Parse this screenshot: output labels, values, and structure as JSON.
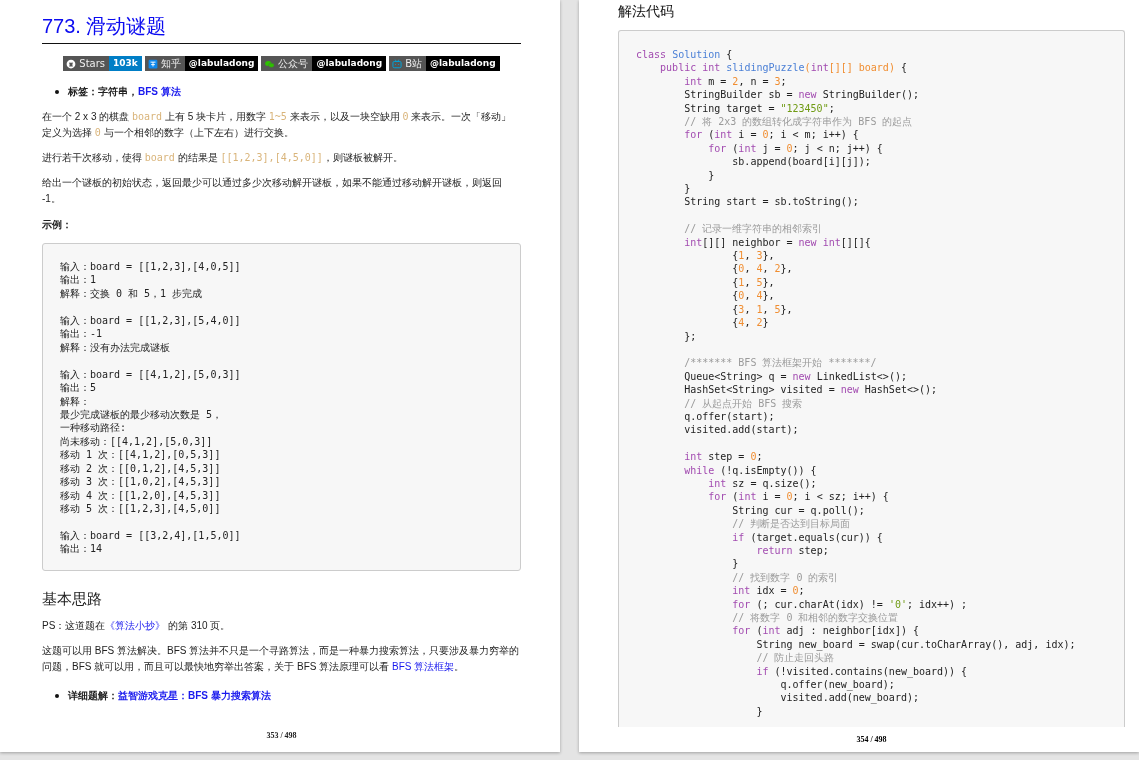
{
  "left_page": {
    "title": "773. 滑动谜题",
    "badges": [
      {
        "kind": "github",
        "label": "Stars",
        "value": "103k"
      },
      {
        "kind": "zhihu",
        "label": "知乎",
        "value": "@labuladong"
      },
      {
        "kind": "wechat",
        "label": "公众号",
        "value": "@labuladong"
      },
      {
        "kind": "bilibili",
        "label": "B站",
        "value": "@labuladong"
      }
    ],
    "blocks": [
      {
        "kind": "bullet",
        "parts": [
          {
            "kind": "text",
            "text": "标签：字符串，"
          },
          {
            "kind": "link",
            "text": "BFS 算法"
          }
        ]
      },
      {
        "kind": "para",
        "parts": [
          {
            "kind": "text",
            "text": "在一个 2 x 3 的棋盘 "
          },
          {
            "kind": "code",
            "text": "board"
          },
          {
            "kind": "text",
            "text": " 上有 5 块卡片，用数字 "
          },
          {
            "kind": "code",
            "text": "1~5"
          },
          {
            "kind": "text",
            "text": " 来表示，以及一块空缺用 "
          },
          {
            "kind": "code",
            "text": "0"
          },
          {
            "kind": "text",
            "text": " 来表示。一次「移动」定义为选择 "
          },
          {
            "kind": "code",
            "text": "0"
          },
          {
            "kind": "text",
            "text": " 与一个相邻的数字（上下左右）进行交换。"
          }
        ]
      },
      {
        "kind": "para",
        "parts": [
          {
            "kind": "text",
            "text": "进行若干次移动，使得 "
          },
          {
            "kind": "code",
            "text": "board"
          },
          {
            "kind": "text",
            "text": " 的结果是 "
          },
          {
            "kind": "code",
            "text": "[[1,2,3],[4,5,0]]"
          },
          {
            "kind": "text",
            "text": "，则谜板被解开。"
          }
        ]
      },
      {
        "kind": "para",
        "parts": [
          {
            "kind": "text",
            "text": "给出一个谜板的初始状态，返回最少可以通过多少次移动解开谜板，如果不能通过移动解开谜板，则返回 -1。"
          }
        ]
      },
      {
        "kind": "label",
        "parts": [
          {
            "kind": "text",
            "text": "示例："
          }
        ]
      },
      {
        "kind": "example",
        "groups": [
          [
            "输入：board = [[1,2,3],[4,0,5]]",
            "输出：1",
            "解释：交换 0 和 5，1 步完成"
          ],
          [
            "输入：board = [[1,2,3],[5,4,0]]",
            "输出：-1",
            "解释：没有办法完成谜板"
          ],
          [
            "输入：board = [[4,1,2],[5,0,3]]",
            "输出：5",
            "解释：",
            "最少完成谜板的最少移动次数是 5，",
            "一种移动路径:",
            "尚未移动：[[4,1,2],[5,0,3]]",
            "移动 1 次：[[4,1,2],[0,5,3]]",
            "移动 2 次：[[0,1,2],[4,5,3]]",
            "移动 3 次：[[1,0,2],[4,5,3]]",
            "移动 4 次：[[1,2,0],[4,5,3]]",
            "移动 5 次：[[1,2,3],[4,5,0]]"
          ],
          [
            "输入：board = [[3,2,4],[1,5,0]]",
            "输出：14"
          ]
        ]
      },
      {
        "kind": "heading",
        "parts": [
          {
            "kind": "text",
            "text": "基本思路"
          }
        ]
      },
      {
        "kind": "para",
        "parts": [
          {
            "kind": "text",
            "text": "PS：这道题在"
          },
          {
            "kind": "link",
            "text": "《算法小抄》"
          },
          {
            "kind": "text",
            "text": " 的第 310 页。"
          }
        ]
      },
      {
        "kind": "para",
        "parts": [
          {
            "kind": "text",
            "text": "这题可以用 BFS 算法解决。BFS 算法并不只是一个寻路算法，而是一种暴力搜索算法，只要涉及暴力穷举的问题，BFS 就可以用，而且可以最快地穷举出答案，关于 BFS 算法原理可以看 "
          },
          {
            "kind": "link",
            "text": "BFS 算法框架"
          },
          {
            "kind": "text",
            "text": "。"
          }
        ]
      },
      {
        "kind": "bullet",
        "parts": [
          {
            "kind": "text",
            "text": "详细题解："
          },
          {
            "kind": "link",
            "text": "益智游戏克星：BFS 暴力搜索算法"
          }
        ]
      }
    ],
    "page_number": "353 / 498"
  },
  "right_page": {
    "heading": "解法代码",
    "code": [
      [
        [
          {
            "kind": "keyword",
            "text": "class"
          },
          {
            "kind": "type",
            "text": " Solution"
          },
          {
            "kind": "plain",
            "text": " {"
          }
        ],
        [
          {
            "kind": "keyword",
            "text": "    public int"
          },
          {
            "kind": "type",
            "text": " slidingPuzzle"
          },
          {
            "kind": "param",
            "text": "("
          },
          {
            "kind": "keyword",
            "text": "int"
          },
          {
            "kind": "param",
            "text": "[][] board)"
          },
          {
            "kind": "plain",
            "text": " {"
          }
        ],
        [
          {
            "kind": "keyword",
            "text": "        int"
          },
          {
            "kind": "plain",
            "text": " m = "
          },
          {
            "kind": "number",
            "text": "2"
          },
          {
            "kind": "plain",
            "text": ", n = "
          },
          {
            "kind": "number",
            "text": "3"
          },
          {
            "kind": "plain",
            "text": ";"
          }
        ],
        [
          {
            "kind": "plain",
            "text": "        StringBuilder sb = "
          },
          {
            "kind": "keyword",
            "text": "new"
          },
          {
            "kind": "plain",
            "text": " StringBuilder();"
          }
        ],
        [
          {
            "kind": "plain",
            "text": "        String target = "
          },
          {
            "kind": "string",
            "text": "\"123450\""
          },
          {
            "kind": "plain",
            "text": ";"
          }
        ],
        [
          {
            "kind": "comment",
            "text": "        // 将 2x3 的数组转化成字符串作为 BFS 的起点"
          }
        ],
        [
          {
            "kind": "keyword",
            "text": "        for"
          },
          {
            "kind": "plain",
            "text": " ("
          },
          {
            "kind": "keyword",
            "text": "int"
          },
          {
            "kind": "plain",
            "text": " i = "
          },
          {
            "kind": "number",
            "text": "0"
          },
          {
            "kind": "plain",
            "text": "; i < m; i++) {"
          }
        ],
        [
          {
            "kind": "keyword",
            "text": "            for"
          },
          {
            "kind": "plain",
            "text": " ("
          },
          {
            "kind": "keyword",
            "text": "int"
          },
          {
            "kind": "plain",
            "text": " j = "
          },
          {
            "kind": "number",
            "text": "0"
          },
          {
            "kind": "plain",
            "text": "; j < n; j++) {"
          }
        ],
        [
          {
            "kind": "plain",
            "text": "                sb.append(board[i][j]);"
          }
        ],
        [
          {
            "kind": "plain",
            "text": "            }"
          }
        ],
        [
          {
            "kind": "plain",
            "text": "        }"
          }
        ],
        [
          {
            "kind": "plain",
            "text": "        String start = sb.toString();"
          }
        ]
      ],
      [
        [
          {
            "kind": "comment",
            "text": "        // 记录一维字符串的相邻索引"
          }
        ],
        [
          {
            "kind": "keyword",
            "text": "        int"
          },
          {
            "kind": "plain",
            "text": "[][] neighbor = "
          },
          {
            "kind": "keyword",
            "text": "new int"
          },
          {
            "kind": "plain",
            "text": "[][]{"
          }
        ],
        [
          {
            "kind": "plain",
            "text": "                {"
          },
          {
            "kind": "number",
            "text": "1"
          },
          {
            "kind": "plain",
            "text": ", "
          },
          {
            "kind": "number",
            "text": "3"
          },
          {
            "kind": "plain",
            "text": "},"
          }
        ],
        [
          {
            "kind": "plain",
            "text": "                {"
          },
          {
            "kind": "number",
            "text": "0"
          },
          {
            "kind": "plain",
            "text": ", "
          },
          {
            "kind": "number",
            "text": "4"
          },
          {
            "kind": "plain",
            "text": ", "
          },
          {
            "kind": "number",
            "text": "2"
          },
          {
            "kind": "plain",
            "text": "},"
          }
        ],
        [
          {
            "kind": "plain",
            "text": "                {"
          },
          {
            "kind": "number",
            "text": "1"
          },
          {
            "kind": "plain",
            "text": ", "
          },
          {
            "kind": "number",
            "text": "5"
          },
          {
            "kind": "plain",
            "text": "},"
          }
        ],
        [
          {
            "kind": "plain",
            "text": "                {"
          },
          {
            "kind": "number",
            "text": "0"
          },
          {
            "kind": "plain",
            "text": ", "
          },
          {
            "kind": "number",
            "text": "4"
          },
          {
            "kind": "plain",
            "text": "},"
          }
        ],
        [
          {
            "kind": "plain",
            "text": "                {"
          },
          {
            "kind": "number",
            "text": "3"
          },
          {
            "kind": "plain",
            "text": ", "
          },
          {
            "kind": "number",
            "text": "1"
          },
          {
            "kind": "plain",
            "text": ", "
          },
          {
            "kind": "number",
            "text": "5"
          },
          {
            "kind": "plain",
            "text": "},"
          }
        ],
        [
          {
            "kind": "plain",
            "text": "                {"
          },
          {
            "kind": "number",
            "text": "4"
          },
          {
            "kind": "plain",
            "text": ", "
          },
          {
            "kind": "number",
            "text": "2"
          },
          {
            "kind": "plain",
            "text": "}"
          }
        ],
        [
          {
            "kind": "plain",
            "text": "        };"
          }
        ]
      ],
      [
        [
          {
            "kind": "comment",
            "text": "        /******* BFS 算法框架开始 *******/"
          }
        ],
        [
          {
            "kind": "plain",
            "text": "        Queue<String> q = "
          },
          {
            "kind": "keyword",
            "text": "new"
          },
          {
            "kind": "plain",
            "text": " LinkedList<>();"
          }
        ],
        [
          {
            "kind": "plain",
            "text": "        HashSet<String> visited = "
          },
          {
            "kind": "keyword",
            "text": "new"
          },
          {
            "kind": "plain",
            "text": " HashSet<>();"
          }
        ],
        [
          {
            "kind": "comment",
            "text": "        // 从起点开始 BFS 搜索"
          }
        ],
        [
          {
            "kind": "plain",
            "text": "        q.offer(start);"
          }
        ],
        [
          {
            "kind": "plain",
            "text": "        visited.add(start);"
          }
        ]
      ],
      [
        [
          {
            "kind": "keyword",
            "text": "        int"
          },
          {
            "kind": "plain",
            "text": " step = "
          },
          {
            "kind": "number",
            "text": "0"
          },
          {
            "kind": "plain",
            "text": ";"
          }
        ],
        [
          {
            "kind": "keyword",
            "text": "        while"
          },
          {
            "kind": "plain",
            "text": " (!q.isEmpty()) {"
          }
        ],
        [
          {
            "kind": "keyword",
            "text": "            int"
          },
          {
            "kind": "plain",
            "text": " sz = q.size();"
          }
        ],
        [
          {
            "kind": "keyword",
            "text": "            for"
          },
          {
            "kind": "plain",
            "text": " ("
          },
          {
            "kind": "keyword",
            "text": "int"
          },
          {
            "kind": "plain",
            "text": " i = "
          },
          {
            "kind": "number",
            "text": "0"
          },
          {
            "kind": "plain",
            "text": "; i < sz; i++) {"
          }
        ],
        [
          {
            "kind": "plain",
            "text": "                String cur = q.poll();"
          }
        ],
        [
          {
            "kind": "comment",
            "text": "                // 判断是否达到目标局面"
          }
        ],
        [
          {
            "kind": "keyword",
            "text": "                if"
          },
          {
            "kind": "plain",
            "text": " (target.equals(cur)) {"
          }
        ],
        [
          {
            "kind": "keyword",
            "text": "                    return"
          },
          {
            "kind": "plain",
            "text": " step;"
          }
        ],
        [
          {
            "kind": "plain",
            "text": "                }"
          }
        ],
        [
          {
            "kind": "comment",
            "text": "                // 找到数字 0 的索引"
          }
        ],
        [
          {
            "kind": "keyword",
            "text": "                int"
          },
          {
            "kind": "plain",
            "text": " idx = "
          },
          {
            "kind": "number",
            "text": "0"
          },
          {
            "kind": "plain",
            "text": ";"
          }
        ],
        [
          {
            "kind": "keyword",
            "text": "                for"
          },
          {
            "kind": "plain",
            "text": " (; cur.charAt(idx) != "
          },
          {
            "kind": "string",
            "text": "'0'"
          },
          {
            "kind": "plain",
            "text": "; idx++) ;"
          }
        ],
        [
          {
            "kind": "comment",
            "text": "                // 将数字 0 和相邻的数字交换位置"
          }
        ],
        [
          {
            "kind": "keyword",
            "text": "                for"
          },
          {
            "kind": "plain",
            "text": " ("
          },
          {
            "kind": "keyword",
            "text": "int"
          },
          {
            "kind": "plain",
            "text": " adj : neighbor[idx]) {"
          }
        ],
        [
          {
            "kind": "plain",
            "text": "                    String new_board = swap(cur.toCharArray(), adj, idx);"
          }
        ],
        [
          {
            "kind": "comment",
            "text": "                    // 防止走回头路"
          }
        ],
        [
          {
            "kind": "keyword",
            "text": "                    if"
          },
          {
            "kind": "plain",
            "text": " (!visited.contains(new_board)) {"
          }
        ],
        [
          {
            "kind": "plain",
            "text": "                        q.offer(new_board);"
          }
        ],
        [
          {
            "kind": "plain",
            "text": "                        visited.add(new_board);"
          }
        ],
        [
          {
            "kind": "plain",
            "text": "                    }"
          }
        ]
      ]
    ],
    "page_number": "354 / 498"
  }
}
